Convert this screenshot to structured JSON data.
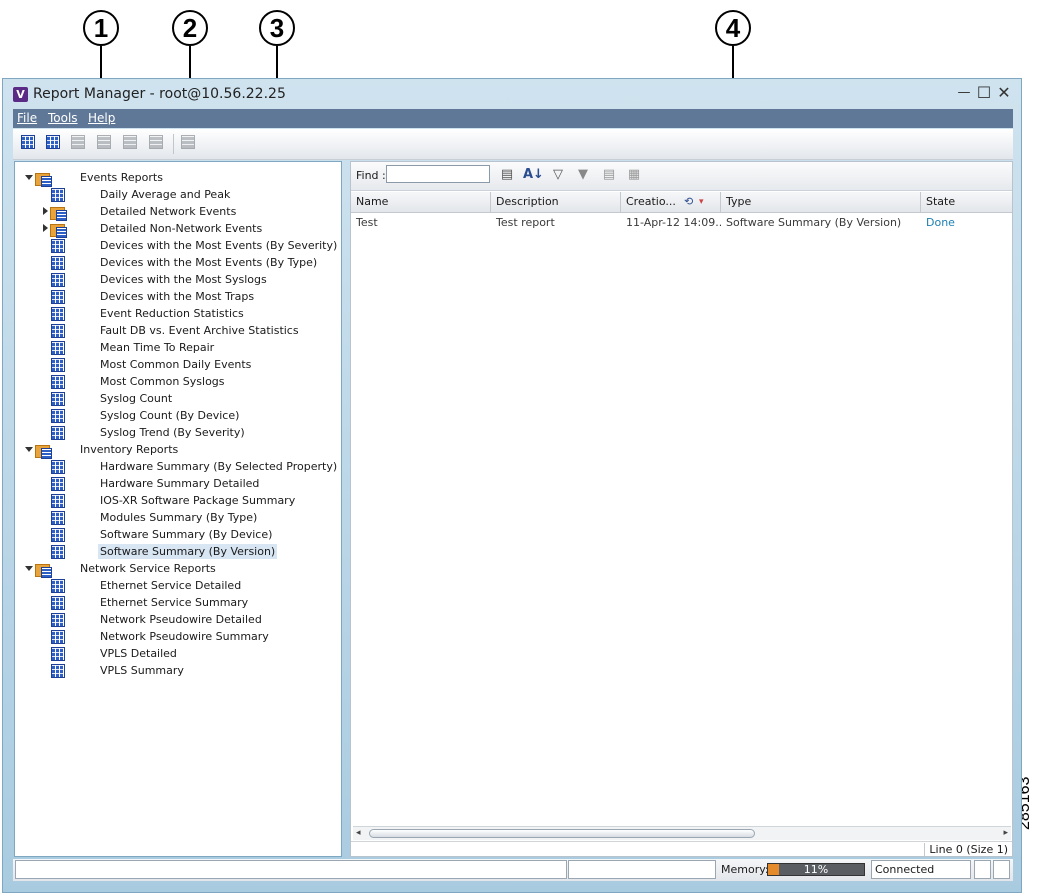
{
  "window": {
    "app_icon": "V",
    "title": "Report Manager - root@10.56.22.25",
    "controls": {
      "minimize": "—",
      "maximize": "☐",
      "close": "✕"
    }
  },
  "menu": {
    "file": "File",
    "tools": "Tools",
    "help": "Help"
  },
  "toolbar_icons": [
    "new-report-icon",
    "new-folder-report-icon",
    "folder-icon",
    "move-icon",
    "export-icon",
    "delete-icon",
    "settings-icon"
  ],
  "tree": {
    "groups": [
      {
        "label": "Events Reports",
        "children": [
          {
            "label": "Daily Average and Peak"
          },
          {
            "label": "Detailed Network Events",
            "expandable": true
          },
          {
            "label": "Detailed Non-Network Events",
            "expandable": true
          },
          {
            "label": "Devices with the Most Events (By Severity)"
          },
          {
            "label": "Devices with the Most Events (By Type)"
          },
          {
            "label": "Devices with the Most Syslogs"
          },
          {
            "label": "Devices with the Most Traps"
          },
          {
            "label": "Event Reduction Statistics"
          },
          {
            "label": "Fault DB vs. Event Archive Statistics"
          },
          {
            "label": "Mean Time To Repair"
          },
          {
            "label": "Most Common Daily Events"
          },
          {
            "label": "Most Common Syslogs"
          },
          {
            "label": "Syslog Count"
          },
          {
            "label": "Syslog Count (By Device)"
          },
          {
            "label": "Syslog Trend (By Severity)"
          }
        ]
      },
      {
        "label": "Inventory Reports",
        "children": [
          {
            "label": "Hardware Summary (By Selected Property)"
          },
          {
            "label": "Hardware Summary Detailed"
          },
          {
            "label": "IOS-XR Software Package Summary"
          },
          {
            "label": "Modules Summary (By Type)"
          },
          {
            "label": "Software Summary (By Device)"
          },
          {
            "label": "Software Summary (By Version)",
            "selected": true
          }
        ]
      },
      {
        "label": "Network Service Reports",
        "children": [
          {
            "label": "Ethernet Service Detailed"
          },
          {
            "label": "Ethernet Service Summary"
          },
          {
            "label": "Network Pseudowire Detailed"
          },
          {
            "label": "Network Pseudowire Summary"
          },
          {
            "label": "VPLS Detailed"
          },
          {
            "label": "VPLS Summary"
          }
        ]
      }
    ]
  },
  "find": {
    "label": "Find :",
    "value": ""
  },
  "table": {
    "columns": [
      "Name",
      "Description",
      "Creatio...",
      "Type",
      "State"
    ],
    "rows": [
      {
        "name": "Test",
        "description": "Test report",
        "creation": "11-Apr-12 14:09...",
        "type": "Software Summary (By Version)",
        "state": "Done"
      }
    ]
  },
  "line_info": "Line 0 (Size 1)",
  "status": {
    "memory_label": "Memory:",
    "memory_percent": 11,
    "memory_text": "11%",
    "connection": "Connected"
  },
  "callouts": [
    "1",
    "2",
    "3",
    "4"
  ],
  "figure_id": "285163",
  "colors": {
    "menubar": "#5f7897",
    "window_frame": "#a9cbe0",
    "selection": "#d8e5f3",
    "state_done": "#1d7fb0",
    "memory_fill": "#e48a2b"
  }
}
